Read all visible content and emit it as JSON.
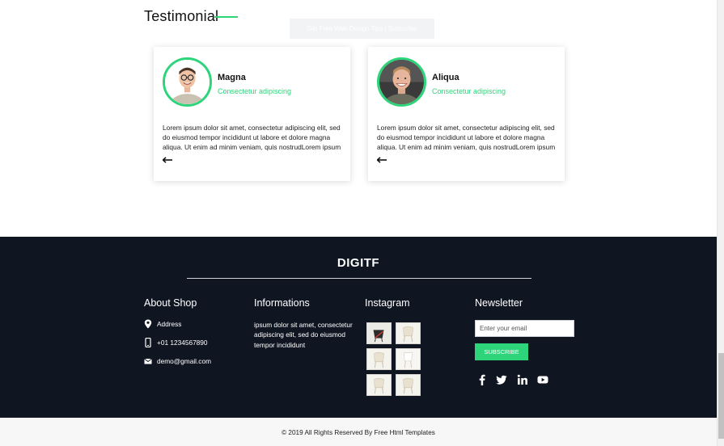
{
  "testimonial": {
    "heading": "Testimonial",
    "overlay_text": "Get Free Web Design Tips | Subscribe",
    "accent": "#2ed47a",
    "cards": [
      {
        "name": "Magna",
        "role": "Consectetur adipiscing",
        "text": "Lorem ipsum dolor sit amet, consectetur adipiscing elit, sed do eiusmod tempor incididunt ut labore et dolore magna aliqua. Ut enim ad minim veniam, quis nostrudLorem ipsum",
        "icon": "arrow-left-icon"
      },
      {
        "name": "Aliqua",
        "role": "Consectetur adipiscing",
        "text": "Lorem ipsum dolor sit amet, consectetur adipiscing elit, sed do eiusmod tempor incididunt ut labore et dolore magna aliqua. Ut enim ad minim veniam, quis nostrudLorem ipsum",
        "icon": "arrow-left-icon"
      }
    ]
  },
  "footer": {
    "brand": "DIGITF",
    "background": "#0f1622",
    "about": {
      "title": "About Shop",
      "address": "Address",
      "phone": "+01 1234567890",
      "email": "demo@gmail.com"
    },
    "informations": {
      "title": "Informations",
      "text": "ipsum dolor sit amet, consectetur adipiscing elit, sed do eiusmod tempor incididunt"
    },
    "instagram": {
      "title": "Instagram",
      "image_count": 6
    },
    "newsletter": {
      "title": "Newsletter",
      "placeholder": "Enter your email",
      "button": "SUBSCRIBE",
      "social_icons": [
        "facebook-icon",
        "twitter-icon",
        "linkedin-icon",
        "youtube-icon"
      ]
    }
  },
  "copyright": "© 2019 All Rights Reserved By Free Html Templates"
}
